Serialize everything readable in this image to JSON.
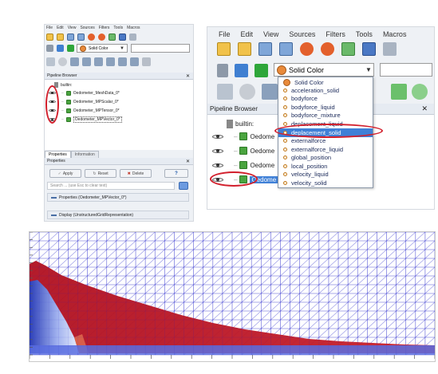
{
  "left_panel": {
    "menu": [
      "File",
      "Edit",
      "View",
      "Sources",
      "Filters",
      "Tools",
      "Macros"
    ],
    "color_combo": "Solid Color",
    "pipeline_browser_title": "Pipeline Browser",
    "tree_root": "builtin:",
    "sources": [
      "Oedometer_MeshData_0*",
      "Oedometer_MPScalar_0*",
      "Oedometer_MPTensor_0*",
      "Oedometer_MPVector_0*"
    ],
    "tabs": [
      "Properties",
      "Information"
    ],
    "properties_title": "Properties",
    "apply_label": "Apply",
    "reset_label": "Reset",
    "delete_label": "Delete",
    "help_label": "?",
    "search_placeholder": "Search ... (use Esc to clear text)",
    "properties_section": "Properties (Oedometer_MPVector_0*)",
    "display_section": "Display (UnstructuredGridRepresentation)"
  },
  "right_panel": {
    "menu": [
      "File",
      "Edit",
      "View",
      "Sources",
      "Filters",
      "Tools",
      "Macros"
    ],
    "color_combo": "Solid Color",
    "pipeline_browser_title": "Pipeline Browser",
    "tree_root": "builtin:",
    "source_prefix": "Oedome",
    "selected_source_prefix": "Oedome",
    "dropdown_header": "Solid Color",
    "dropdown_items": [
      "acceleration_solid",
      "bodyforce",
      "bodyforce_liquid",
      "bodyforce_mixture",
      "deplacement_liquid",
      "deplacement_solid",
      "externalforce",
      "externalforce_liquid",
      "global_position",
      "local_position",
      "velocity_liquid",
      "velocity_solid"
    ],
    "selected_item": "deplacement_solid"
  },
  "colors": {
    "highlight": "#d21f2c",
    "selection": "#3f80d7",
    "mesh_line": "#3a3ad0",
    "particle_red": "#b01020"
  }
}
